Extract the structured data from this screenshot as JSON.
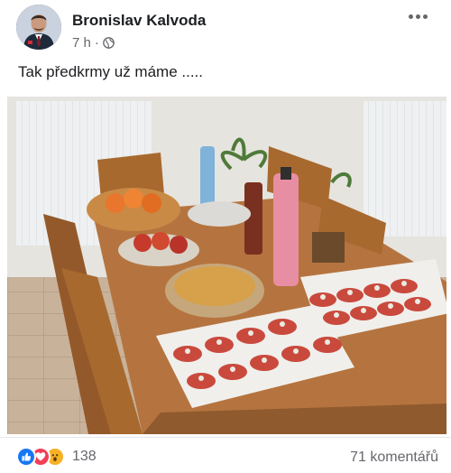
{
  "post": {
    "author_name": "Bronislav Kalvoda",
    "timestamp": "7 h",
    "meta_separator": "·",
    "privacy_icon": "globe-icon",
    "text": "Tak předkrmy už máme .....",
    "photo_description_icon": "photo"
  },
  "footer": {
    "reaction_icons": [
      "like-icon",
      "love-icon",
      "wow-icon"
    ],
    "reaction_count": "138",
    "comments_label": "71 komentářů"
  },
  "colors": {
    "author_text": "#1c1e21",
    "meta_text": "#65676b",
    "like": "#1877f2",
    "love": "#f33e58",
    "wow": "#f7b125"
  }
}
